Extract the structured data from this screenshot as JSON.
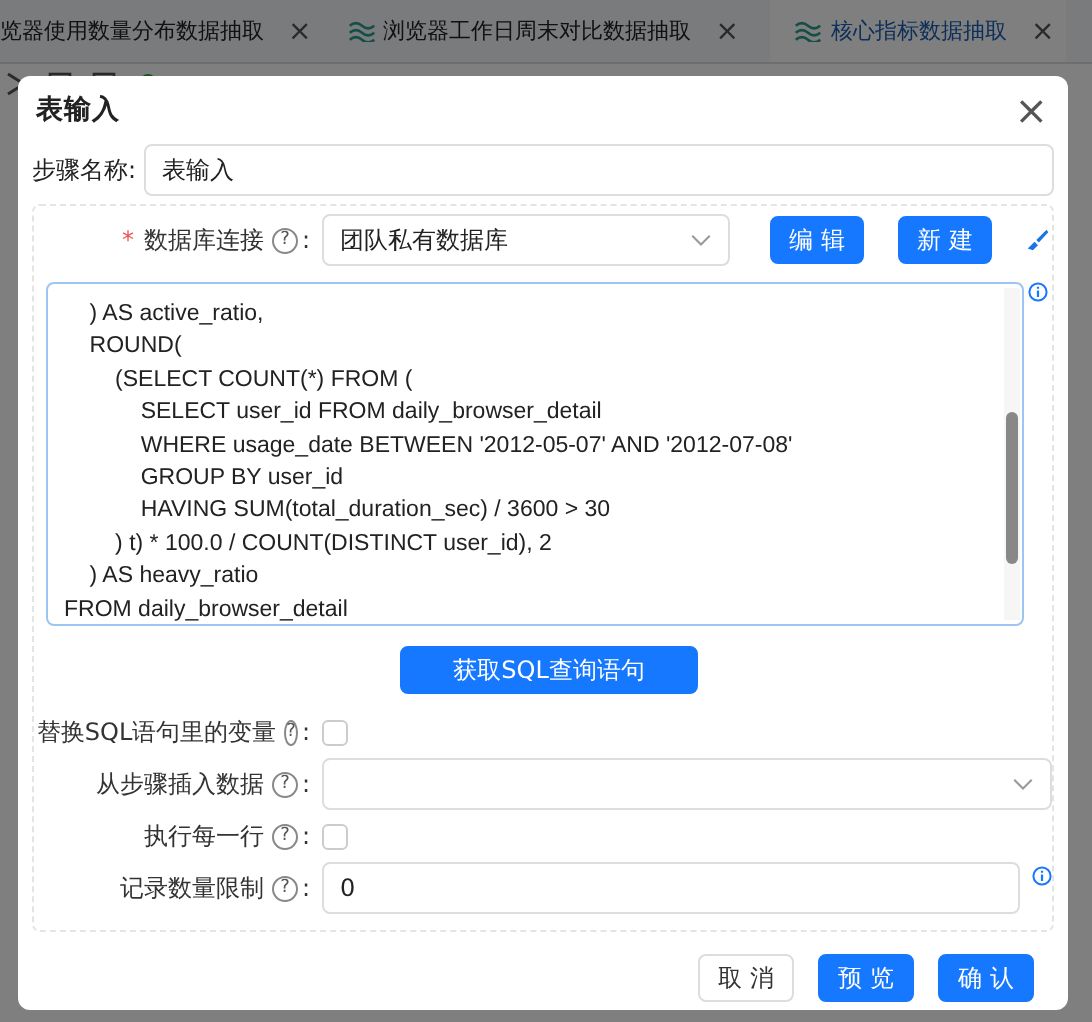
{
  "tabs": [
    {
      "label": "览器使用数量分布数据抽取",
      "close": "×",
      "selected": false,
      "icon": false
    },
    {
      "label": "浏览器工作日周末对比数据抽取",
      "close": "×",
      "selected": false,
      "icon": true
    },
    {
      "label": "核心指标数据抽取",
      "close": "×",
      "selected": true,
      "icon": true
    }
  ],
  "dialog": {
    "title": "表输入",
    "close": "×",
    "step_name": {
      "label": "步骤名称:",
      "value": "表输入"
    },
    "connection": {
      "required_mark": "*",
      "label": "数据库连接",
      "help": "?",
      "colon": ":",
      "value": "团队私有数据库",
      "buttons": [
        "编 辑",
        "新 建"
      ]
    },
    "sql": "    ) AS active_ratio,\n    ROUND(\n        (SELECT COUNT(*) FROM (\n            SELECT user_id FROM daily_browser_detail\n            WHERE usage_date BETWEEN '2012-05-07' AND '2012-07-08'\n            GROUP BY user_id\n            HAVING SUM(total_duration_sec) / 3600 > 30\n        ) t) * 100.0 / COUNT(DISTINCT user_id), 2\n    ) AS heavy_ratio\nFROM daily_browser_detail",
    "get_sql_button": "获取SQL查询语句",
    "options": [
      {
        "kind": "checkbox",
        "label": "替换SQL语句里的变量",
        "help": "?",
        "colon": ":",
        "checked": false
      },
      {
        "kind": "select",
        "label": "从步骤插入数据",
        "help": "?",
        "colon": ":"
      },
      {
        "kind": "checkbox",
        "label": "执行每一行",
        "help": "?",
        "colon": ":",
        "checked": false
      },
      {
        "kind": "input",
        "label": "记录数量限制",
        "help": "?",
        "colon": ":",
        "value": "0"
      }
    ],
    "footer": [
      {
        "label": "取 消",
        "primary": false
      },
      {
        "label": "预 览",
        "primary": true
      },
      {
        "label": "确 认",
        "primary": true
      }
    ]
  }
}
